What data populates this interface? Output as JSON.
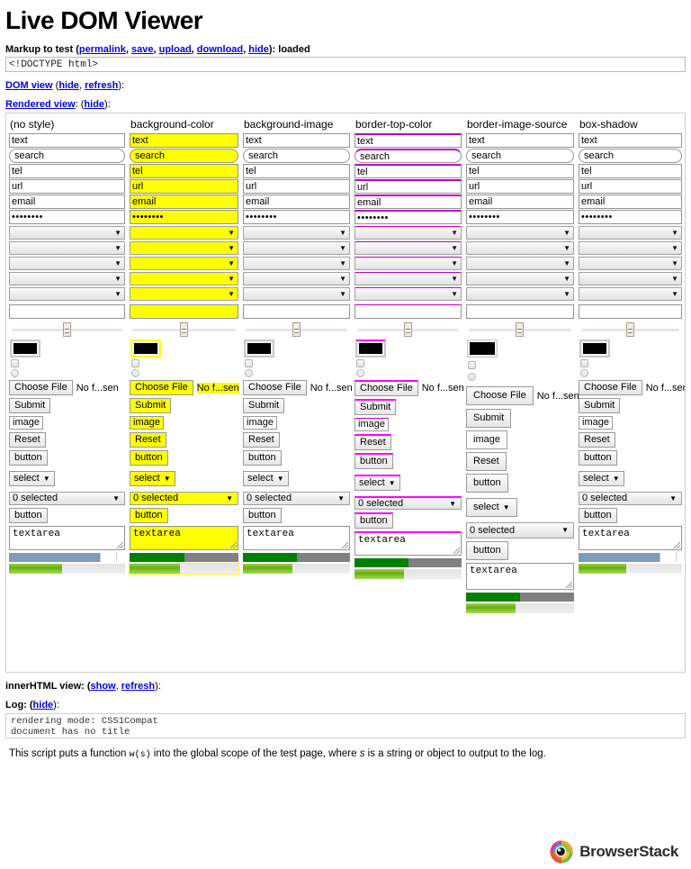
{
  "page": {
    "title": "Live DOM Viewer"
  },
  "markup": {
    "label_prefix": "Markup to test (",
    "links": [
      "permalink",
      "save",
      "upload",
      "download",
      "hide"
    ],
    "label_suffix": "): loaded",
    "value": "<!DOCTYPE html>"
  },
  "dom_view": {
    "label": "DOM view",
    "open_paren": " (",
    "links": [
      "hide",
      "refresh"
    ],
    "close": "):"
  },
  "rendered_view": {
    "label": "Rendered view",
    "open_paren": ": (",
    "links": [
      "hide"
    ],
    "close": "):"
  },
  "inner_html_view": {
    "label": "innerHTML view: (",
    "links": [
      "show",
      "refresh"
    ],
    "close": "):"
  },
  "log": {
    "label": "Log: (",
    "links": [
      "hide"
    ],
    "close": "):",
    "lines": [
      "rendering mode: CSS1Compat",
      "document has no title"
    ]
  },
  "footnote": {
    "part1": "This script puts a function ",
    "code": "w(s)",
    "part2": " into the global scope of the test page, where ",
    "var": "s",
    "part3": " is a string or object to output to the log."
  },
  "branding": {
    "name": "BrowserStack"
  },
  "colors": {
    "link": "#0000ee",
    "highlight_yellow": "#ffff00",
    "border_magenta": "#ff00ff",
    "progress_green": "#008000",
    "progress_gray": "#808080",
    "progress_blue": "#7d9cb8",
    "meter_green": "#6fba1c"
  },
  "columns": [
    {
      "header": "(no style)",
      "widgets": {
        "text_inputs": [
          "text",
          "search",
          "tel",
          "url",
          "email",
          "••••••••"
        ],
        "selects": [
          "",
          "",
          "",
          "",
          ""
        ],
        "number": "",
        "range": "",
        "color": "",
        "checkbox": "",
        "radio": "",
        "file_button": "Choose File",
        "file_status": "No f...sen",
        "submit": "Submit",
        "image": "image",
        "reset": "Reset",
        "button": "button",
        "select_single": "select",
        "select_multi": "0 selected",
        "button2": "button",
        "textarea": "textarea",
        "progress_style": "blue",
        "meter": "meter"
      }
    },
    {
      "header": "background-color",
      "widgets": {
        "text_inputs": [
          "text",
          "search",
          "tel",
          "url",
          "email",
          "••••••••"
        ],
        "selects": [
          "",
          "",
          "",
          "",
          ""
        ],
        "number": "",
        "range": "",
        "color": "",
        "checkbox": "",
        "radio": "",
        "file_button": "Choose File",
        "file_status": "No f...sen",
        "submit": "Submit",
        "image": "image",
        "reset": "Reset",
        "button": "button",
        "select_single": "select",
        "select_multi": "0 selected",
        "button2": "button",
        "textarea": "textarea",
        "progress_style": "green",
        "meter": "meter"
      }
    },
    {
      "header": "background-image",
      "widgets": {
        "text_inputs": [
          "text",
          "search",
          "tel",
          "url",
          "email",
          "••••••••"
        ],
        "selects": [
          "",
          "",
          "",
          "",
          ""
        ],
        "number": "",
        "range": "",
        "color": "",
        "checkbox": "",
        "radio": "",
        "file_button": "Choose File",
        "file_status": "No f...sen",
        "submit": "Submit",
        "image": "image",
        "reset": "Reset",
        "button": "button",
        "select_single": "select",
        "select_multi": "0 selected",
        "button2": "button",
        "textarea": "textarea",
        "progress_style": "green",
        "meter": "meter"
      }
    },
    {
      "header": "border-top-color",
      "widgets": {
        "text_inputs": [
          "text",
          "search",
          "tel",
          "url",
          "email",
          "••••••••"
        ],
        "selects": [
          "",
          "",
          "",
          "",
          ""
        ],
        "number": "",
        "range": "",
        "color": "",
        "checkbox": "",
        "radio": "",
        "file_button": "Choose File",
        "file_status": "No f...sen",
        "submit": "Submit",
        "image": "image",
        "reset": "Reset",
        "button": "button",
        "select_single": "select",
        "select_multi": "0 selected",
        "button2": "button",
        "textarea": "textarea",
        "progress_style": "green",
        "meter": "meter"
      }
    },
    {
      "header": "border-image-source",
      "widgets": {
        "text_inputs": [
          "text",
          "search",
          "tel",
          "url",
          "email",
          "••••••••"
        ],
        "selects": [
          "",
          "",
          "",
          "",
          ""
        ],
        "number": "",
        "range": "",
        "color": "",
        "checkbox": "",
        "radio": "",
        "file_button": "Choose File",
        "file_status": "No f...sen",
        "submit": "Submit",
        "image": "image",
        "reset": "Reset",
        "button": "button",
        "select_single": "select",
        "select_multi": "0 selected",
        "button2": "button",
        "textarea": "textarea",
        "progress_style": "green",
        "meter": "meter"
      }
    },
    {
      "header": "box-shadow",
      "widgets": {
        "text_inputs": [
          "text",
          "search",
          "tel",
          "url",
          "email",
          "••••••••"
        ],
        "selects": [
          "",
          "",
          "",
          "",
          ""
        ],
        "number": "",
        "range": "",
        "color": "",
        "checkbox": "",
        "radio": "",
        "file_button": "Choose File",
        "file_status": "No f...sen",
        "submit": "Submit",
        "image": "image",
        "reset": "Reset",
        "button": "button",
        "select_single": "select",
        "select_multi": "0 selected",
        "button2": "button",
        "textarea": "textarea",
        "progress_style": "blue",
        "meter": "meter"
      }
    }
  ]
}
